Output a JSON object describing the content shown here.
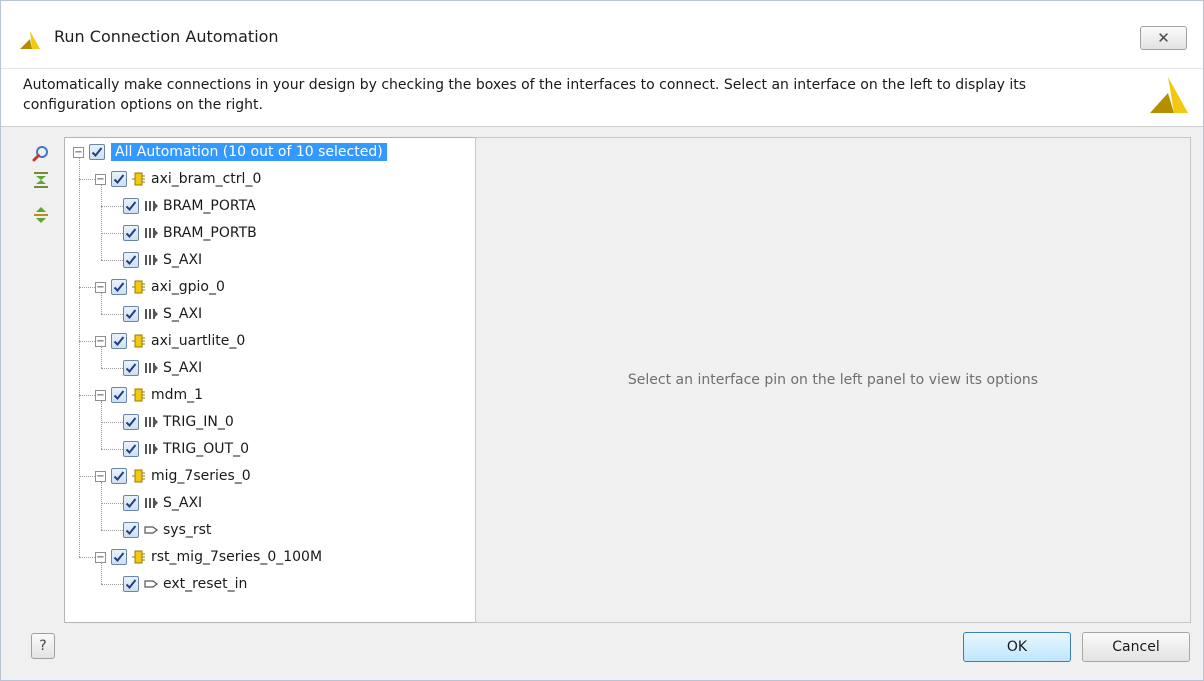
{
  "window": {
    "title": "Run Connection Automation",
    "close_glyph": "✕"
  },
  "description": "Automatically make connections in your design by checking the boxes of the interfaces to connect. Select an interface on the left to display its configuration options on the right.",
  "toolbar": {
    "icons": [
      "search-icon",
      "collapse-all-icon",
      "expand-all-icon"
    ]
  },
  "tree": {
    "root": {
      "label": "All Automation (10 out of 10 selected)",
      "checked": true,
      "expanded": true
    },
    "groups": [
      {
        "label": "axi_bram_ctrl_0",
        "checked": true,
        "expanded": true,
        "children": [
          {
            "label": "BRAM_PORTA",
            "type": "interface",
            "checked": true
          },
          {
            "label": "BRAM_PORTB",
            "type": "interface",
            "checked": true
          },
          {
            "label": "S_AXI",
            "type": "interface",
            "checked": true
          }
        ]
      },
      {
        "label": "axi_gpio_0",
        "checked": true,
        "expanded": true,
        "children": [
          {
            "label": "S_AXI",
            "type": "interface",
            "checked": true
          }
        ]
      },
      {
        "label": "axi_uartlite_0",
        "checked": true,
        "expanded": true,
        "children": [
          {
            "label": "S_AXI",
            "type": "interface",
            "checked": true
          }
        ]
      },
      {
        "label": "mdm_1",
        "checked": true,
        "expanded": true,
        "children": [
          {
            "label": "TRIG_IN_0",
            "type": "interface",
            "checked": true
          },
          {
            "label": "TRIG_OUT_0",
            "type": "interface",
            "checked": true
          }
        ]
      },
      {
        "label": "mig_7series_0",
        "checked": true,
        "expanded": true,
        "children": [
          {
            "label": "S_AXI",
            "type": "interface",
            "checked": true
          },
          {
            "label": "sys_rst",
            "type": "pin",
            "checked": true
          }
        ]
      },
      {
        "label": "rst_mig_7series_0_100M",
        "checked": true,
        "expanded": true,
        "children": [
          {
            "label": "ext_reset_in",
            "type": "pin",
            "checked": true
          }
        ]
      }
    ]
  },
  "options_panel": {
    "message": "Select an interface pin on the left panel to view its options"
  },
  "buttons": {
    "help": "?",
    "ok": "OK",
    "cancel": "Cancel"
  },
  "colors": {
    "selection": "#3399ff",
    "check": "#1f3f8a",
    "logo_yellow": "#f2c811",
    "logo_dark": "#b58e00"
  }
}
